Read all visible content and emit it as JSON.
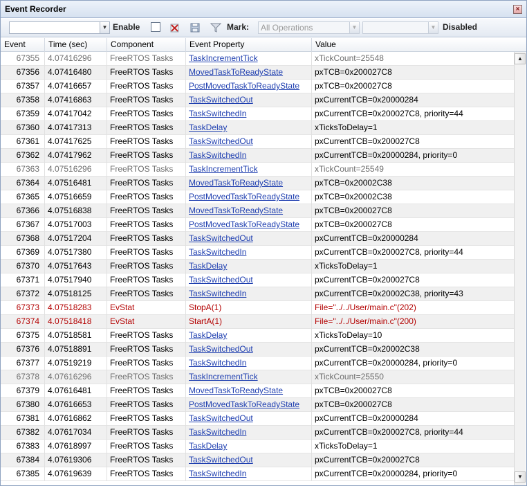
{
  "window": {
    "title": "Event Recorder",
    "close_glyph": "×"
  },
  "toolbar": {
    "filter_value": "",
    "enable_label": "Enable",
    "mark_label": "Mark:",
    "operations_value": "All Operations",
    "mark_value2": "",
    "status_label": "Disabled",
    "icons": [
      "clear-icon",
      "save-icon",
      "filter-icon"
    ]
  },
  "columns": [
    "Event",
    "Time (sec)",
    "Component",
    "Event Property",
    "Value"
  ],
  "rows": [
    {
      "event": "67355",
      "time": "4.07416296",
      "component": "FreeRTOS Tasks",
      "property": "TaskIncrementTick",
      "value": "xTickCount=25548",
      "style": "gray"
    },
    {
      "event": "67356",
      "time": "4.07416480",
      "component": "FreeRTOS Tasks",
      "property": "MovedTaskToReadyState",
      "value": "pxTCB=0x200027C8",
      "style": "normal"
    },
    {
      "event": "67357",
      "time": "4.07416657",
      "component": "FreeRTOS Tasks",
      "property": "PostMovedTaskToReadyState",
      "value": "pxTCB=0x200027C8",
      "style": "normal"
    },
    {
      "event": "67358",
      "time": "4.07416863",
      "component": "FreeRTOS Tasks",
      "property": "TaskSwitchedOut",
      "value": "pxCurrentTCB=0x20000284",
      "style": "normal"
    },
    {
      "event": "67359",
      "time": "4.07417042",
      "component": "FreeRTOS Tasks",
      "property": "TaskSwitchedIn",
      "value": "pxCurrentTCB=0x200027C8, priority=44",
      "style": "normal"
    },
    {
      "event": "67360",
      "time": "4.07417313",
      "component": "FreeRTOS Tasks",
      "property": "TaskDelay",
      "value": "xTicksToDelay=1",
      "style": "normal"
    },
    {
      "event": "67361",
      "time": "4.07417625",
      "component": "FreeRTOS Tasks",
      "property": "TaskSwitchedOut",
      "value": "pxCurrentTCB=0x200027C8",
      "style": "normal"
    },
    {
      "event": "67362",
      "time": "4.07417962",
      "component": "FreeRTOS Tasks",
      "property": "TaskSwitchedIn",
      "value": "pxCurrentTCB=0x20000284, priority=0",
      "style": "normal"
    },
    {
      "event": "67363",
      "time": "4.07516296",
      "component": "FreeRTOS Tasks",
      "property": "TaskIncrementTick",
      "value": "xTickCount=25549",
      "style": "gray"
    },
    {
      "event": "67364",
      "time": "4.07516481",
      "component": "FreeRTOS Tasks",
      "property": "MovedTaskToReadyState",
      "value": "pxTCB=0x20002C38",
      "style": "normal"
    },
    {
      "event": "67365",
      "time": "4.07516659",
      "component": "FreeRTOS Tasks",
      "property": "PostMovedTaskToReadyState",
      "value": "pxTCB=0x20002C38",
      "style": "normal"
    },
    {
      "event": "67366",
      "time": "4.07516838",
      "component": "FreeRTOS Tasks",
      "property": "MovedTaskToReadyState",
      "value": "pxTCB=0x200027C8",
      "style": "normal"
    },
    {
      "event": "67367",
      "time": "4.07517003",
      "component": "FreeRTOS Tasks",
      "property": "PostMovedTaskToReadyState",
      "value": "pxTCB=0x200027C8",
      "style": "normal"
    },
    {
      "event": "67368",
      "time": "4.07517204",
      "component": "FreeRTOS Tasks",
      "property": "TaskSwitchedOut",
      "value": "pxCurrentTCB=0x20000284",
      "style": "normal"
    },
    {
      "event": "67369",
      "time": "4.07517380",
      "component": "FreeRTOS Tasks",
      "property": "TaskSwitchedIn",
      "value": "pxCurrentTCB=0x200027C8, priority=44",
      "style": "normal"
    },
    {
      "event": "67370",
      "time": "4.07517643",
      "component": "FreeRTOS Tasks",
      "property": "TaskDelay",
      "value": "xTicksToDelay=1",
      "style": "normal"
    },
    {
      "event": "67371",
      "time": "4.07517940",
      "component": "FreeRTOS Tasks",
      "property": "TaskSwitchedOut",
      "value": "pxCurrentTCB=0x200027C8",
      "style": "normal"
    },
    {
      "event": "67372",
      "time": "4.07518125",
      "component": "FreeRTOS Tasks",
      "property": "TaskSwitchedIn",
      "value": "pxCurrentTCB=0x20002C38, priority=43",
      "style": "normal"
    },
    {
      "event": "67373",
      "time": "4.07518283",
      "component": "EvStat",
      "property": "StopA(1)",
      "value": "File=\"../../User/main.c\"(202)",
      "style": "red"
    },
    {
      "event": "67374",
      "time": "4.07518418",
      "component": "EvStat",
      "property": "StartA(1)",
      "value": "File=\"../../User/main.c\"(200)",
      "style": "red"
    },
    {
      "event": "67375",
      "time": "4.07518581",
      "component": "FreeRTOS Tasks",
      "property": "TaskDelay",
      "value": "xTicksToDelay=10",
      "style": "normal"
    },
    {
      "event": "67376",
      "time": "4.07518891",
      "component": "FreeRTOS Tasks",
      "property": "TaskSwitchedOut",
      "value": "pxCurrentTCB=0x20002C38",
      "style": "normal"
    },
    {
      "event": "67377",
      "time": "4.07519219",
      "component": "FreeRTOS Tasks",
      "property": "TaskSwitchedIn",
      "value": "pxCurrentTCB=0x20000284, priority=0",
      "style": "normal"
    },
    {
      "event": "67378",
      "time": "4.07616296",
      "component": "FreeRTOS Tasks",
      "property": "TaskIncrementTick",
      "value": "xTickCount=25550",
      "style": "gray"
    },
    {
      "event": "67379",
      "time": "4.07616481",
      "component": "FreeRTOS Tasks",
      "property": "MovedTaskToReadyState",
      "value": "pxTCB=0x200027C8",
      "style": "normal"
    },
    {
      "event": "67380",
      "time": "4.07616653",
      "component": "FreeRTOS Tasks",
      "property": "PostMovedTaskToReadyState",
      "value": "pxTCB=0x200027C8",
      "style": "normal"
    },
    {
      "event": "67381",
      "time": "4.07616862",
      "component": "FreeRTOS Tasks",
      "property": "TaskSwitchedOut",
      "value": "pxCurrentTCB=0x20000284",
      "style": "normal"
    },
    {
      "event": "67382",
      "time": "4.07617034",
      "component": "FreeRTOS Tasks",
      "property": "TaskSwitchedIn",
      "value": "pxCurrentTCB=0x200027C8, priority=44",
      "style": "normal"
    },
    {
      "event": "67383",
      "time": "4.07618997",
      "component": "FreeRTOS Tasks",
      "property": "TaskDelay",
      "value": "xTicksToDelay=1",
      "style": "normal"
    },
    {
      "event": "67384",
      "time": "4.07619306",
      "component": "FreeRTOS Tasks",
      "property": "TaskSwitchedOut",
      "value": "pxCurrentTCB=0x200027C8",
      "style": "normal"
    },
    {
      "event": "67385",
      "time": "4.07619639",
      "component": "FreeRTOS Tasks",
      "property": "TaskSwitchedIn",
      "value": "pxCurrentTCB=0x20000284, priority=0",
      "style": "normal"
    }
  ],
  "scrollbar": {
    "up_glyph": "▲",
    "down_glyph": "▼",
    "position": 1.0
  }
}
